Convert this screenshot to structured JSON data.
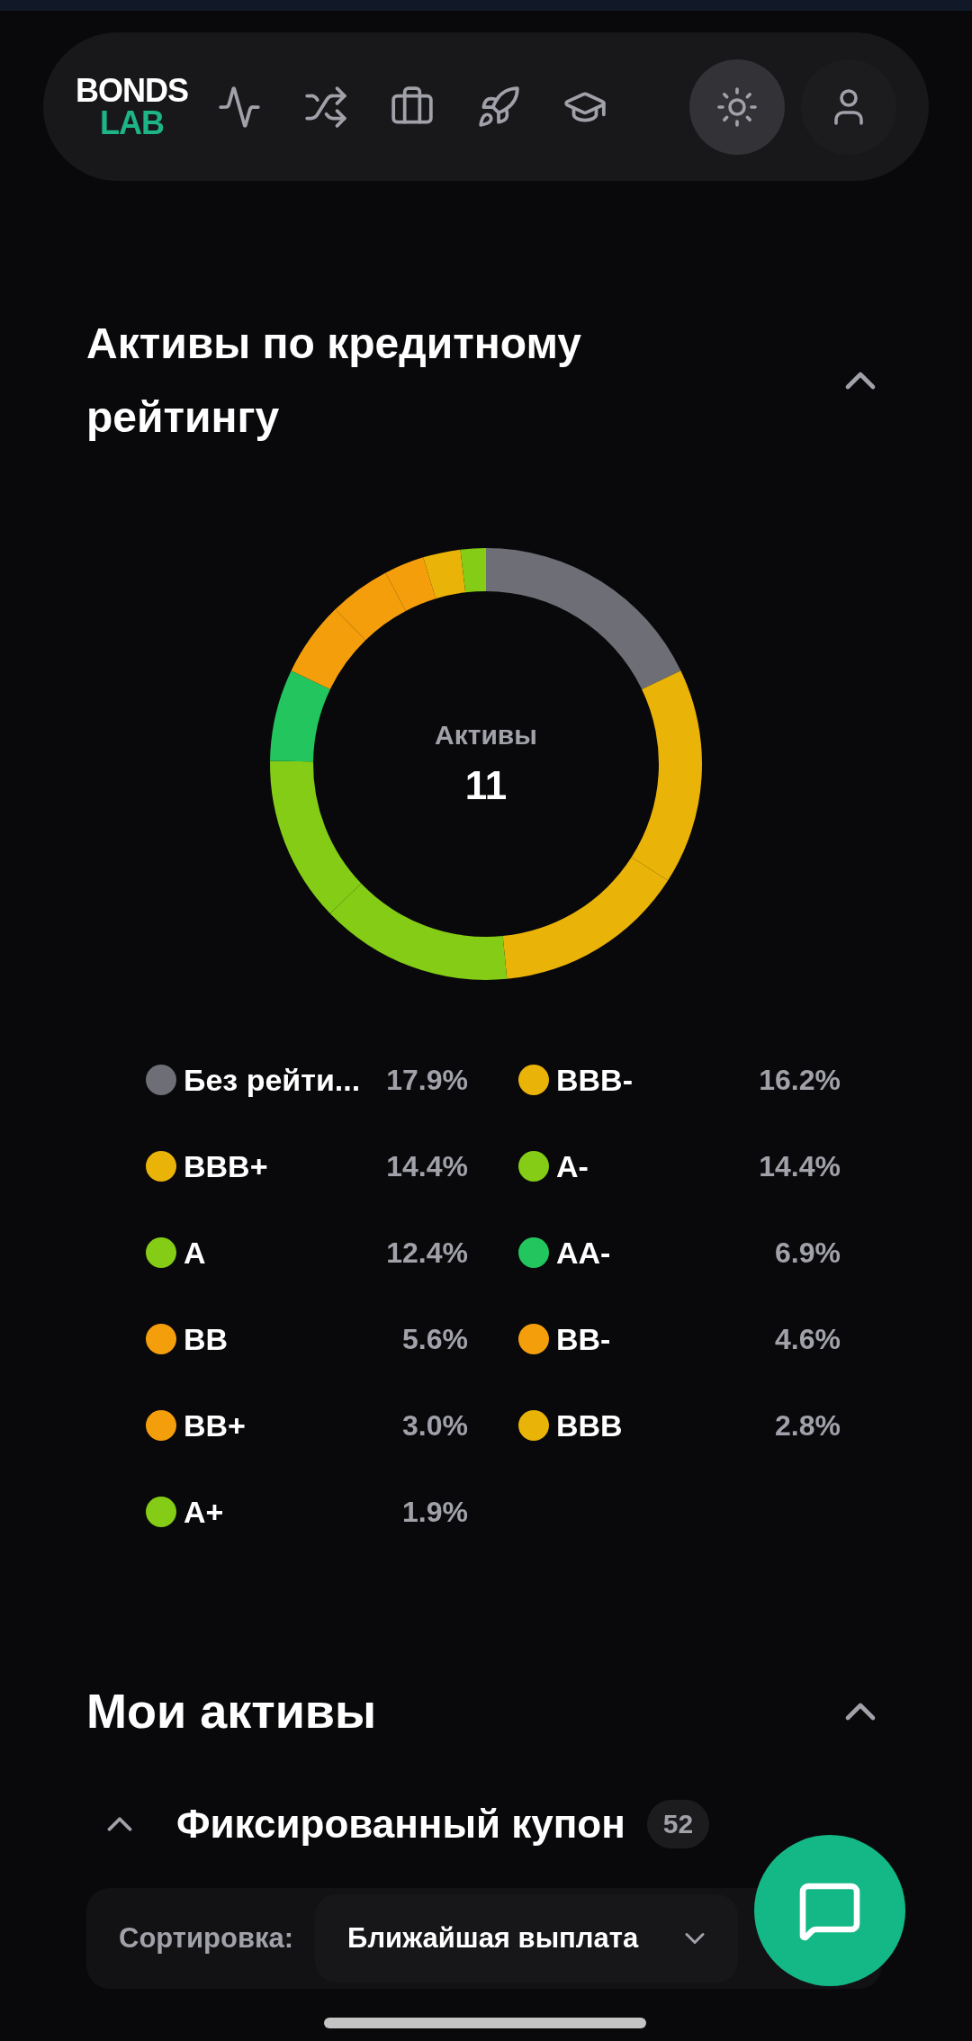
{
  "nav": {
    "logo_top": "BONDS",
    "logo_bottom": "LAB",
    "items": [
      {
        "kind": "activity"
      },
      {
        "kind": "shuffle"
      },
      {
        "kind": "briefcase"
      },
      {
        "kind": "rocket"
      },
      {
        "kind": "education"
      }
    ],
    "actions": [
      {
        "kind": "theme",
        "selected": true
      },
      {
        "kind": "profile",
        "selected": false
      }
    ]
  },
  "rating_section": {
    "title": "Активы по кредитному рейтингу",
    "expanded": true,
    "center_label": "Активы",
    "center_value": "11",
    "chart_data": {
      "type": "donut",
      "values": [
        17.9,
        16.2,
        14.4,
        14.4,
        12.4,
        6.9,
        5.6,
        4.6,
        3.0,
        2.8,
        1.9
      ]
    },
    "legend": [
      {
        "label": "Без рейти...",
        "value": "17.9%",
        "color": "#6e6f76"
      },
      {
        "label": "BBB-",
        "value": "16.2%",
        "color": "#eab308"
      },
      {
        "label": "BBB+",
        "value": "14.4%",
        "color": "#eab308"
      },
      {
        "label": "A-",
        "value": "14.4%",
        "color": "#84cc16"
      },
      {
        "label": "A",
        "value": "12.4%",
        "color": "#84cc16"
      },
      {
        "label": "AA-",
        "value": "6.9%",
        "color": "#22c55e"
      },
      {
        "label": "BB",
        "value": "5.6%",
        "color": "#f59e0b"
      },
      {
        "label": "BB-",
        "value": "4.6%",
        "color": "#f59e0b"
      },
      {
        "label": "BB+",
        "value": "3.0%",
        "color": "#f59e0b"
      },
      {
        "label": "BBB",
        "value": "2.8%",
        "color": "#eab308"
      },
      {
        "label": "A+",
        "value": "1.9%",
        "color": "#84cc16"
      }
    ]
  },
  "assets_section": {
    "title": "Мои активы",
    "expanded": true,
    "group": {
      "title": "Фиксированный купон",
      "count": "52",
      "expanded": true
    },
    "sort": {
      "label": "Сортировка:",
      "value": "Ближайшая выплата"
    }
  }
}
